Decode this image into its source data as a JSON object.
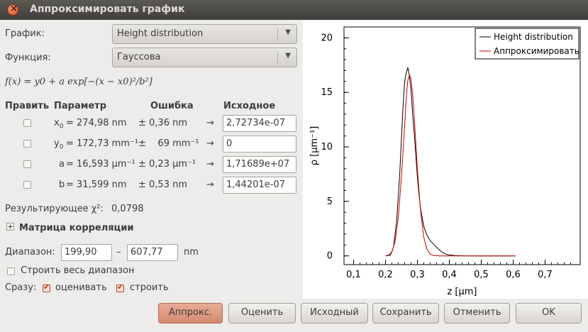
{
  "window": {
    "title": "Аппроксимировать график"
  },
  "graph_row": {
    "label": "График:",
    "value": "Height distribution"
  },
  "function_row": {
    "label": "Функция:",
    "value": "Гауссова"
  },
  "formula": "f(x) = y0 + a exp[−(x − x0)²/b²]",
  "table": {
    "headers": {
      "fix": "Править",
      "param": "Параметр",
      "error": "Ошибка",
      "initial": "Исходное"
    },
    "rows": [
      {
        "name": "x",
        "sub": "0",
        "eq": "= 274,98 nm",
        "pm": "± 0,36 nm",
        "arrow": "→",
        "initial": "2,72734e-07"
      },
      {
        "name": "y",
        "sub": "0",
        "eq": "= 172,73 mm⁻¹",
        "pm": "±    69 mm⁻¹",
        "arrow": "→",
        "initial": "0"
      },
      {
        "name": "a",
        "sub": "",
        "eq": "= 16,593 µm⁻¹",
        "pm": "± 0,23 µm⁻¹",
        "arrow": "→",
        "initial": "1,71689e+07"
      },
      {
        "name": "b",
        "sub": "",
        "eq": "= 31,599 nm",
        "pm": "± 0,53 nm",
        "arrow": "→",
        "initial": "1,44201e-07"
      }
    ]
  },
  "chi_label": "Результирующее χ²:",
  "chi_value": "0,0798",
  "correlation": {
    "expander": "+",
    "label": "Матрица корреляции"
  },
  "range": {
    "label": "Диапазон:",
    "from": "199,90",
    "dash": "–",
    "to": "607,77",
    "unit": "nm"
  },
  "full_range": {
    "label": "Строить весь диапазон",
    "checked": false
  },
  "instant": {
    "label": "Сразу:",
    "estimate": "оценивать",
    "plot": "строить"
  },
  "buttons": {
    "fit": "Аппрокс.",
    "estimate": "Оценить",
    "initial": "Исходный",
    "save": "Сохранить",
    "cancel": "Отменить",
    "ok": "OK"
  },
  "chart_data": {
    "type": "line",
    "xlabel": "z [µm]",
    "ylabel": "ρ [µm⁻¹]",
    "xlim": [
      0.07,
      0.81
    ],
    "ylim": [
      -0.8,
      21
    ],
    "xticks": [
      "0,1",
      "0,2",
      "0,3",
      "0,4",
      "0,5",
      "0,6",
      "0,7"
    ],
    "xtick_values": [
      0.1,
      0.2,
      0.3,
      0.4,
      0.5,
      0.6,
      0.7
    ],
    "yticks": [
      "0",
      "5",
      "10",
      "15",
      "20"
    ],
    "ytick_values": [
      0,
      5,
      10,
      15,
      20
    ],
    "legend_position": "top-right",
    "series": [
      {
        "name": "Height distribution",
        "color": "#000000",
        "x": [
          0.2,
          0.215,
          0.225,
          0.235,
          0.245,
          0.25,
          0.255,
          0.26,
          0.265,
          0.27,
          0.275,
          0.28,
          0.285,
          0.29,
          0.295,
          0.3,
          0.305,
          0.31,
          0.32,
          0.33,
          0.34,
          0.35,
          0.36,
          0.37,
          0.38,
          0.39,
          0.4,
          0.42,
          0.45,
          0.5,
          0.55,
          0.6,
          0.607
        ],
        "y": [
          0,
          0.05,
          0.8,
          3.2,
          7.8,
          10.8,
          13.8,
          16.0,
          16.8,
          17.3,
          16.5,
          15.2,
          13.0,
          11.3,
          9.2,
          7.2,
          5.6,
          4.3,
          2.7,
          1.9,
          1.4,
          1.1,
          0.8,
          0.5,
          0.3,
          0.15,
          0.08,
          0.03,
          0.01,
          0,
          0,
          0,
          0
        ]
      },
      {
        "name": "Аппроксимировать",
        "color": "#cc0000",
        "x": [
          0.2,
          0.21,
          0.22,
          0.23,
          0.24,
          0.25,
          0.255,
          0.26,
          0.265,
          0.27,
          0.275,
          0.28,
          0.285,
          0.29,
          0.295,
          0.3,
          0.31,
          0.32,
          0.33,
          0.34,
          0.35,
          0.37,
          0.4,
          0.45,
          0.5,
          0.55,
          0.607
        ],
        "y": [
          0.0,
          0.08,
          0.36,
          1.3,
          3.5,
          7.3,
          9.6,
          12.0,
          14.5,
          16.1,
          16.6,
          16.2,
          14.8,
          12.7,
          10.3,
          7.9,
          4.1,
          1.7,
          0.6,
          0.17,
          0.04,
          0.0,
          0,
          0,
          0,
          0,
          0
        ]
      }
    ]
  }
}
